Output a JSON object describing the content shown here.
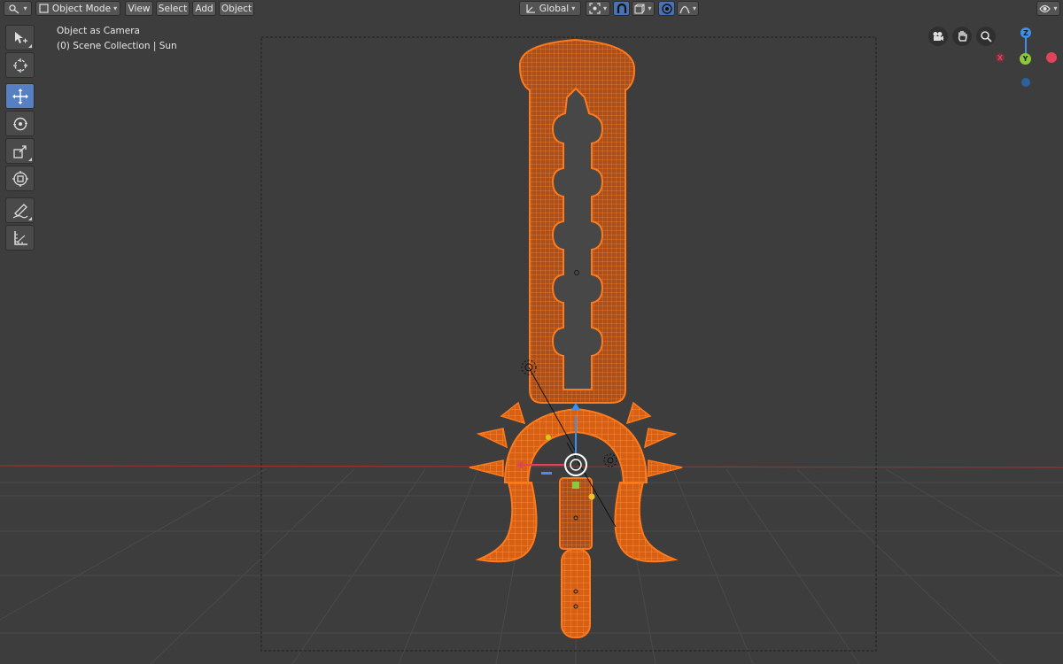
{
  "header": {
    "editor_icon": "view3d-editor-icon",
    "mode": "Object Mode",
    "menus": [
      "View",
      "Select",
      "Add",
      "Object"
    ],
    "orientation": "Global",
    "pivot_icon": "pivot-point-icon",
    "snap_icon": "magnet-snap-icon",
    "proportional_icon": "proportional-edit-icon",
    "falloff_icon": "falloff-curve-icon",
    "visibility_icon": "eye-visibility-icon"
  },
  "overlay": {
    "view_name": "Object as Camera",
    "collection": "(0) Scene Collection | Sun"
  },
  "toolbar": {
    "tools": [
      "select-box-icon",
      "cursor-icon",
      "move-icon",
      "rotate-icon",
      "scale-icon",
      "transform-icon",
      "annotate-icon",
      "measure-icon"
    ],
    "active_tool": "move-icon"
  },
  "navigation": {
    "buttons": [
      "camera-view-icon",
      "hand-pan-icon",
      "zoom-icon"
    ],
    "gizmo": {
      "x": "X",
      "y": "Y",
      "z": "Z"
    }
  },
  "colors": {
    "background": "#3d3d3d",
    "selection": "#ff6a00",
    "active_tool": "#5680c2",
    "axis_x": "#e0445a",
    "axis_y": "#8cc83b",
    "axis_z": "#3f8fe8"
  }
}
